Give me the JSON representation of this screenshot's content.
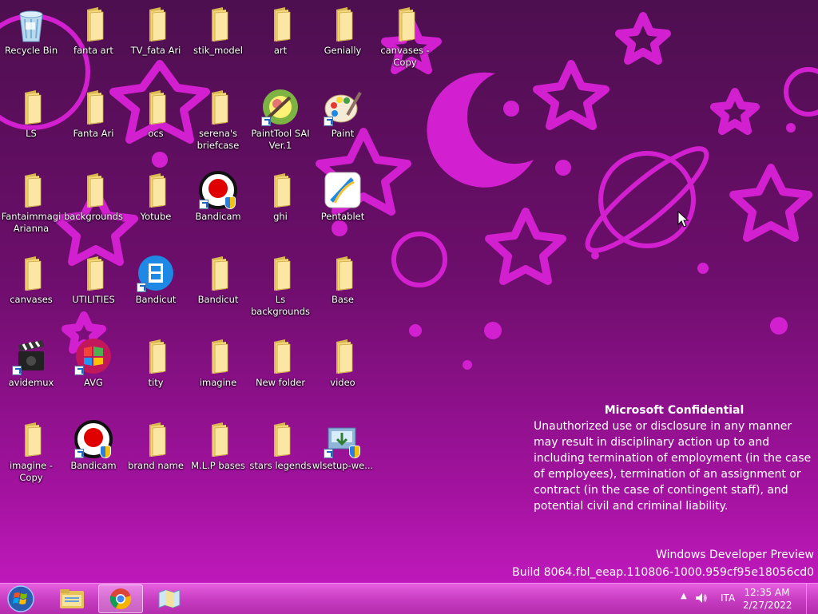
{
  "desktop": {
    "icons": [
      {
        "label": "Recycle Bin",
        "type": "recycle"
      },
      {
        "label": "LS",
        "type": "folder"
      },
      {
        "label": "Fantaimmagi Arianna",
        "type": "folder"
      },
      {
        "label": "canvases",
        "type": "folder"
      },
      {
        "label": "avidemux",
        "type": "clapper",
        "shortcut": true
      },
      {
        "label": "imagine - Copy",
        "type": "folder"
      },
      {
        "label": "fanta art",
        "type": "folder"
      },
      {
        "label": "Fanta Ari",
        "type": "folder"
      },
      {
        "label": "backgrounds",
        "type": "folder"
      },
      {
        "label": "UTILITIES",
        "type": "folder"
      },
      {
        "label": "AVG",
        "type": "avg",
        "shortcut": true
      },
      {
        "label": "Bandicam",
        "type": "record",
        "shortcut": true,
        "shield": true
      },
      {
        "label": "TV_fata Ari",
        "type": "folder"
      },
      {
        "label": "ocs",
        "type": "folder"
      },
      {
        "label": "Yotube",
        "type": "folder"
      },
      {
        "label": "Bandicut",
        "type": "film",
        "shortcut": true
      },
      {
        "label": "tity",
        "type": "folder"
      },
      {
        "label": "brand name",
        "type": "folder"
      },
      {
        "label": "stik_model",
        "type": "folder"
      },
      {
        "label": "serena's briefcase",
        "type": "folder"
      },
      {
        "label": "Bandicam",
        "type": "record",
        "shortcut": true,
        "shield": true
      },
      {
        "label": "Bandicut",
        "type": "folder"
      },
      {
        "label": "imagine",
        "type": "folder"
      },
      {
        "label": "M.L.P bases",
        "type": "folder"
      },
      {
        "label": "art",
        "type": "folder"
      },
      {
        "label": "PaintTool SAI Ver.1",
        "type": "sai",
        "shortcut": true
      },
      {
        "label": "ghi",
        "type": "folder"
      },
      {
        "label": "Ls backgrounds",
        "type": "folder"
      },
      {
        "label": "New folder",
        "type": "folder"
      },
      {
        "label": "stars legends",
        "type": "folder"
      },
      {
        "label": "Genially",
        "type": "folder"
      },
      {
        "label": "Paint",
        "type": "palette",
        "shortcut": true
      },
      {
        "label": "Pentablet",
        "type": "pentablet"
      },
      {
        "label": "Base",
        "type": "folder"
      },
      {
        "label": "video",
        "type": "folder"
      },
      {
        "label": "wlsetup-we...",
        "type": "setup",
        "shortcut": true,
        "shield": true
      },
      {
        "label": "canvases - Copy",
        "type": "folder"
      }
    ]
  },
  "watermark": {
    "title": "Microsoft Confidential",
    "body": "Unauthorized use or disclosure in any manner may result in disciplinary action up to and including termination of employment (in the case of employees), termination of an assignment or contract (in the case of contingent staff), and potential civil and criminal liability.",
    "product": "Windows Developer Preview",
    "build": "Build 8064.fbl_eeap.110806-1000.959cf95e18056cd0"
  },
  "taskbar": {
    "language": "ITA",
    "time": "12:35 AM",
    "date": "2/27/2022"
  },
  "colors": {
    "accent": "#e14ae0",
    "taskbar": "#c93ec3",
    "folder": "#f3d77a"
  }
}
